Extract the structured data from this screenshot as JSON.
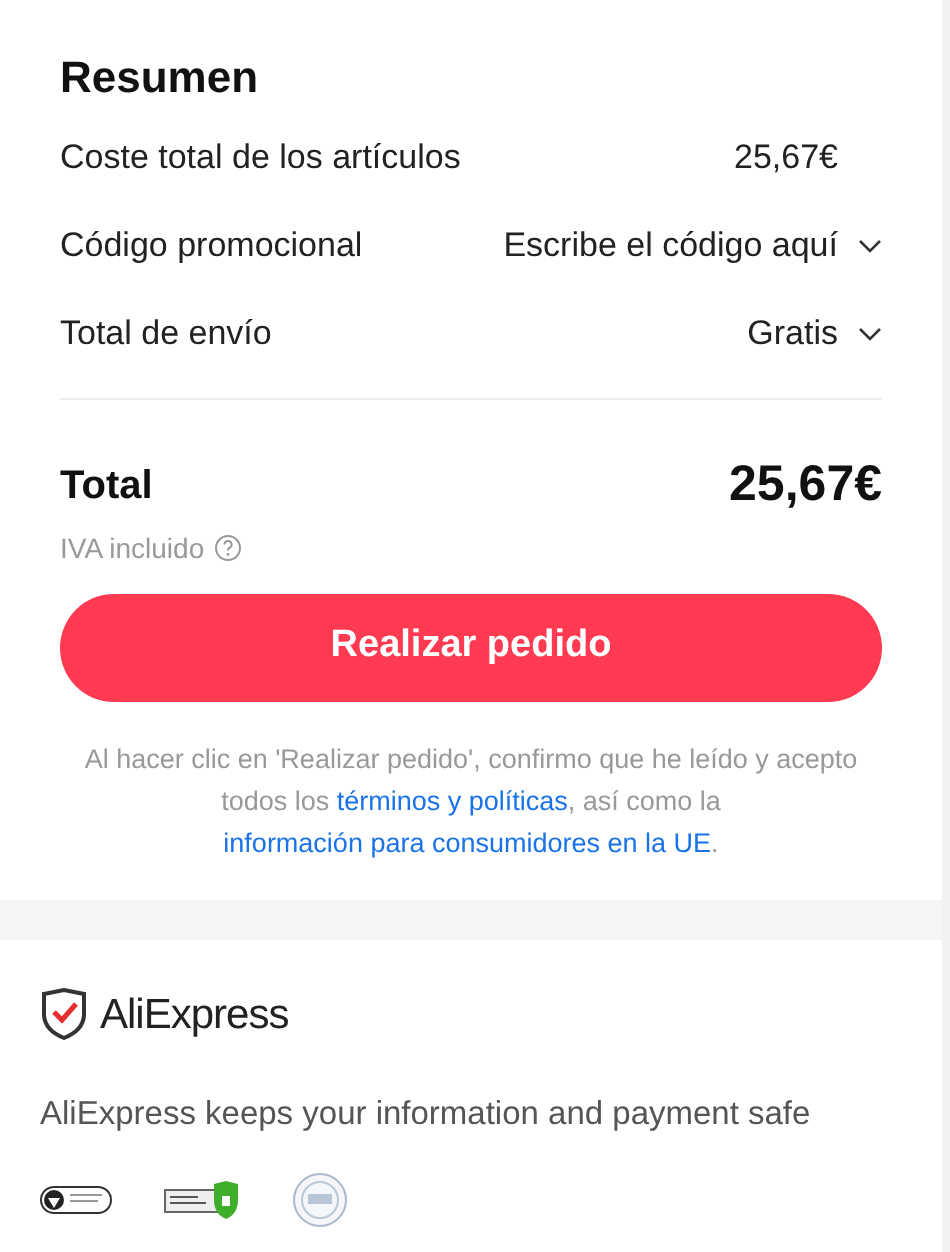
{
  "summary": {
    "title": "Resumen",
    "rows": [
      {
        "kind": "plain",
        "label": "Coste total de los artículos",
        "value": "25,67€"
      },
      {
        "kind": "dropdown",
        "label": "Código promocional",
        "value": "Escribe el código aquí"
      },
      {
        "kind": "dropdown",
        "label": "Total de envío",
        "value": "Gratis"
      }
    ],
    "total": {
      "label": "Total",
      "value": "25,67€",
      "note": "IVA incluido"
    },
    "button": "Realizar pedido",
    "legal": [
      {
        "kind": "text",
        "text": "Al hacer clic en 'Realizar pedido', confirmo que he leído y acepto todos los "
      },
      {
        "kind": "link",
        "text": "términos y políticas"
      },
      {
        "kind": "text",
        "text": ", así como la "
      },
      {
        "kind": "link",
        "text": "información para consumidores en la UE"
      },
      {
        "kind": "text",
        "text": "."
      }
    ]
  },
  "trust": {
    "brand": "AliExpress",
    "message": "AliExpress keeps your information and payment safe"
  }
}
